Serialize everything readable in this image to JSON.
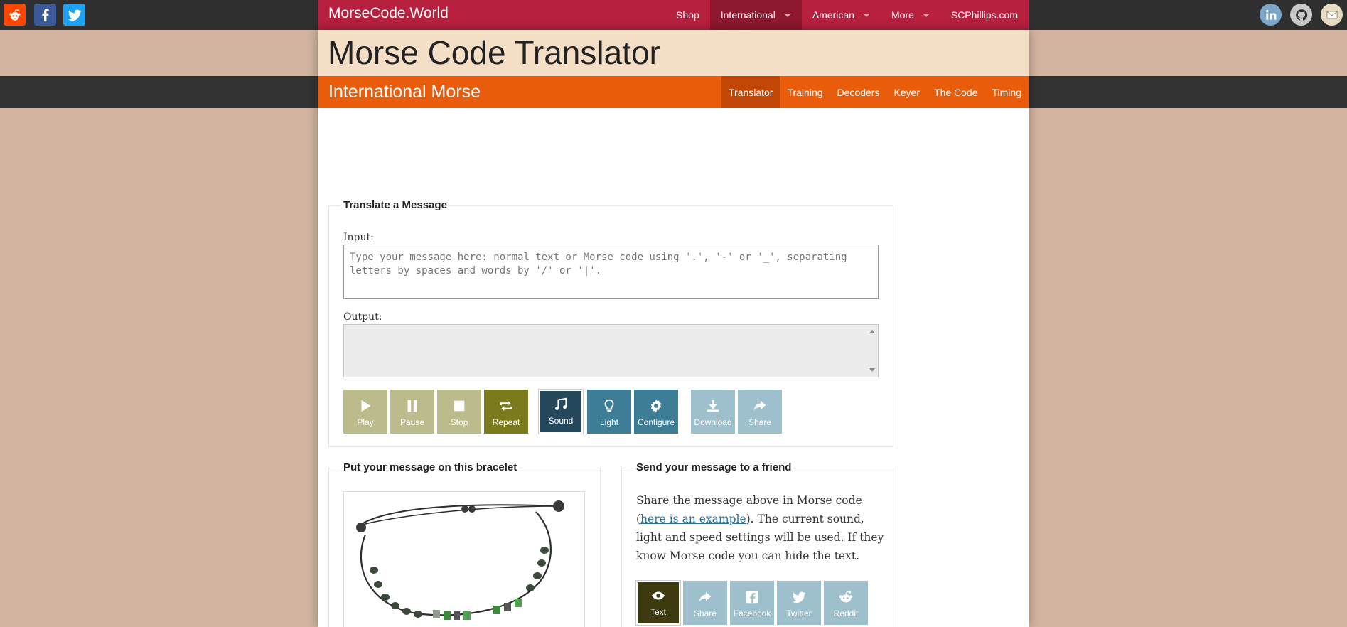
{
  "social_left": [
    {
      "icon": "reddit-icon",
      "color": "#ff4500"
    },
    {
      "icon": "facebook-icon",
      "color": "#3b5998"
    },
    {
      "icon": "twitter-icon",
      "color": "#1da1f2"
    }
  ],
  "social_right": [
    {
      "icon": "linkedin-icon"
    },
    {
      "icon": "github-icon"
    },
    {
      "icon": "email-icon"
    }
  ],
  "brand": "MorseCode.World",
  "top_nav": [
    {
      "label": "Shop",
      "active": false,
      "dropdown": false
    },
    {
      "label": "International",
      "active": true,
      "dropdown": true
    },
    {
      "label": "American",
      "active": false,
      "dropdown": true
    },
    {
      "label": "More",
      "active": false,
      "dropdown": true
    },
    {
      "label": "SCPhillips.com",
      "active": false,
      "dropdown": false
    }
  ],
  "page_title": "Morse Code Translator",
  "section_title": "International Morse",
  "sub_nav": [
    {
      "label": "Translator",
      "active": true
    },
    {
      "label": "Training",
      "active": false
    },
    {
      "label": "Decoders",
      "active": false
    },
    {
      "label": "Keyer",
      "active": false
    },
    {
      "label": "The Code",
      "active": false
    },
    {
      "label": "Timing",
      "active": false
    }
  ],
  "translate": {
    "legend": "Translate a Message",
    "input_label": "Input:",
    "input_placeholder": "Type your message here: normal text or Morse code using '.', '-' or '_', separating letters by spaces and words by '/' or '|'.",
    "input_value": "",
    "output_label": "Output:",
    "output_value": "",
    "buttons": {
      "play": "Play",
      "pause": "Pause",
      "stop": "Stop",
      "repeat": "Repeat",
      "sound": "Sound",
      "light": "Light",
      "configure": "Configure",
      "download": "Download",
      "share": "Share"
    }
  },
  "bracelet": {
    "legend": "Put your message on this bracelet"
  },
  "send": {
    "legend": "Send your message to a friend",
    "text_before": "Share the message above in Morse code (",
    "link": "here is an example",
    "text_after": "). The current sound, light and speed settings will be used. If they know Morse code you can hide the text.",
    "buttons": {
      "text": "Text",
      "share": "Share",
      "facebook": "Facebook",
      "twitter": "Twitter",
      "reddit": "Reddit"
    }
  },
  "colors": {
    "brand_red": "#b8203f",
    "orange": "#e85c0c",
    "khaki": "#bbbb8c",
    "olive": "#7b7a1c",
    "teal": "#3d7d95",
    "teal_dark": "#24475b",
    "light_teal": "#9ec0cc",
    "dark_olive": "#3d3a10"
  }
}
